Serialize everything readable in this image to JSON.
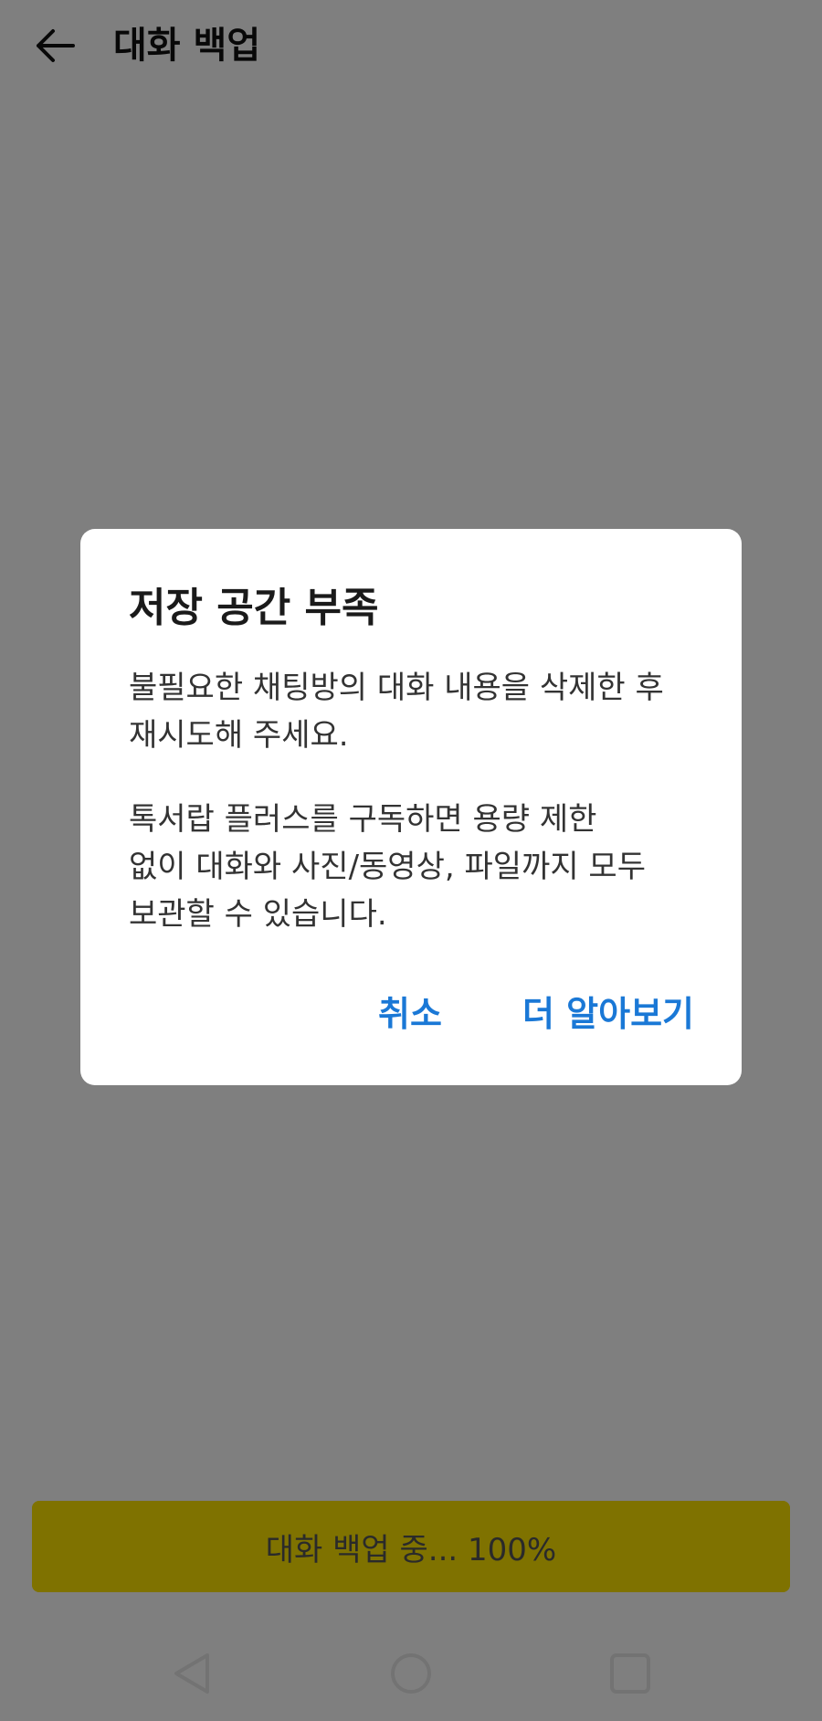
{
  "appbar": {
    "title": "대화 백업"
  },
  "backup": {
    "label": "대화 백업 중... 100%",
    "progress_percent": 100,
    "color": "#fee500"
  },
  "dialog": {
    "title": "저장 공간 부족",
    "message1": "불필요한 채팅방의 대화 내용을 삭제한 후\n재시도해 주세요.",
    "message2": "톡서랍 플러스를 구독하면 용량 제한\n없이 대화와 사진/동영상, 파일까지 모두\n보관할 수 있습니다.",
    "cancel_label": "취소",
    "learn_more_label": "더 알아보기",
    "accent_color": "#1a78d6"
  },
  "navbar": {
    "icons": [
      "back-triangle-icon",
      "home-circle-icon",
      "recents-square-icon"
    ]
  }
}
